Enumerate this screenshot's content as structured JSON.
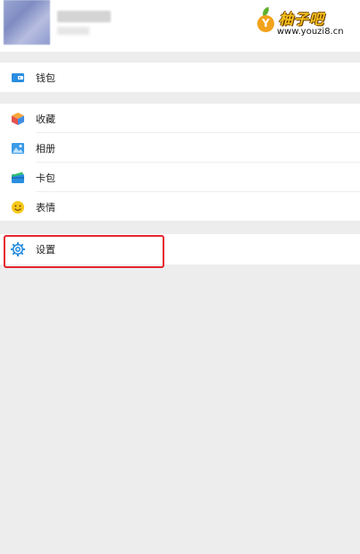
{
  "watermark": {
    "badge_letter": "Y",
    "title": "柚子吧",
    "url": "www.youzi8.cn"
  },
  "menu": {
    "wallet": {
      "label": "钱包",
      "icon": "wallet-icon"
    },
    "items": [
      {
        "label": "收藏",
        "icon": "favorites-cube-icon"
      },
      {
        "label": "相册",
        "icon": "photo-album-icon"
      },
      {
        "label": "卡包",
        "icon": "card-pack-icon"
      },
      {
        "label": "表情",
        "icon": "emoji-smiley-icon"
      }
    ],
    "settings": {
      "label": "设置",
      "icon": "settings-gear-icon"
    }
  },
  "colors": {
    "page_background": "#ededed",
    "highlight_border": "#e5262e",
    "icon_blue": "#2a8ee0",
    "icon_yellow": "#f5c81b",
    "icon_green": "#2bb559"
  }
}
